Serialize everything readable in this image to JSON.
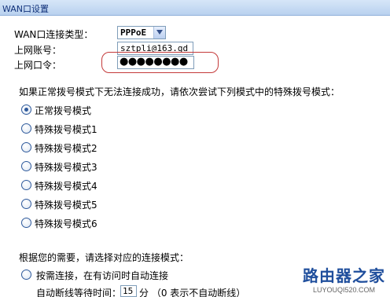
{
  "title": "WAN口设置",
  "connection_type_label": "WAN口连接类型：",
  "connection_type_value": "PPPoE",
  "account_label": "上网账号：",
  "account_value": "sztpli@163.gd",
  "password_label": "上网口令：",
  "password_value": "●●●●●●●●",
  "dial_mode_prompt": "如果正常拨号模式下无法连接成功，请依次尝试下列模式中的特殊拨号模式：",
  "dial_modes": [
    {
      "label": "正常拨号模式",
      "checked": true
    },
    {
      "label": "特殊拨号模式1",
      "checked": false
    },
    {
      "label": "特殊拨号模式2",
      "checked": false
    },
    {
      "label": "特殊拨号模式3",
      "checked": false
    },
    {
      "label": "特殊拨号模式4",
      "checked": false
    },
    {
      "label": "特殊拨号模式5",
      "checked": false
    },
    {
      "label": "特殊拨号模式6",
      "checked": false
    }
  ],
  "connect_mode_prompt": "根据您的需要，请选择对应的连接模式：",
  "on_demand_label": "按需连接，在有访问时自动连接",
  "idle_wait_label": "自动断线等待时间：",
  "idle_wait_value": "15",
  "idle_wait_unit": "分 （0 表示不自动断线）",
  "watermark_text": "路由器之家",
  "watermark_url": "LUYOUQI520.COM",
  "colors": {
    "highlight_oval": "#c43a3a",
    "title_bar": "#c8dcf4"
  }
}
